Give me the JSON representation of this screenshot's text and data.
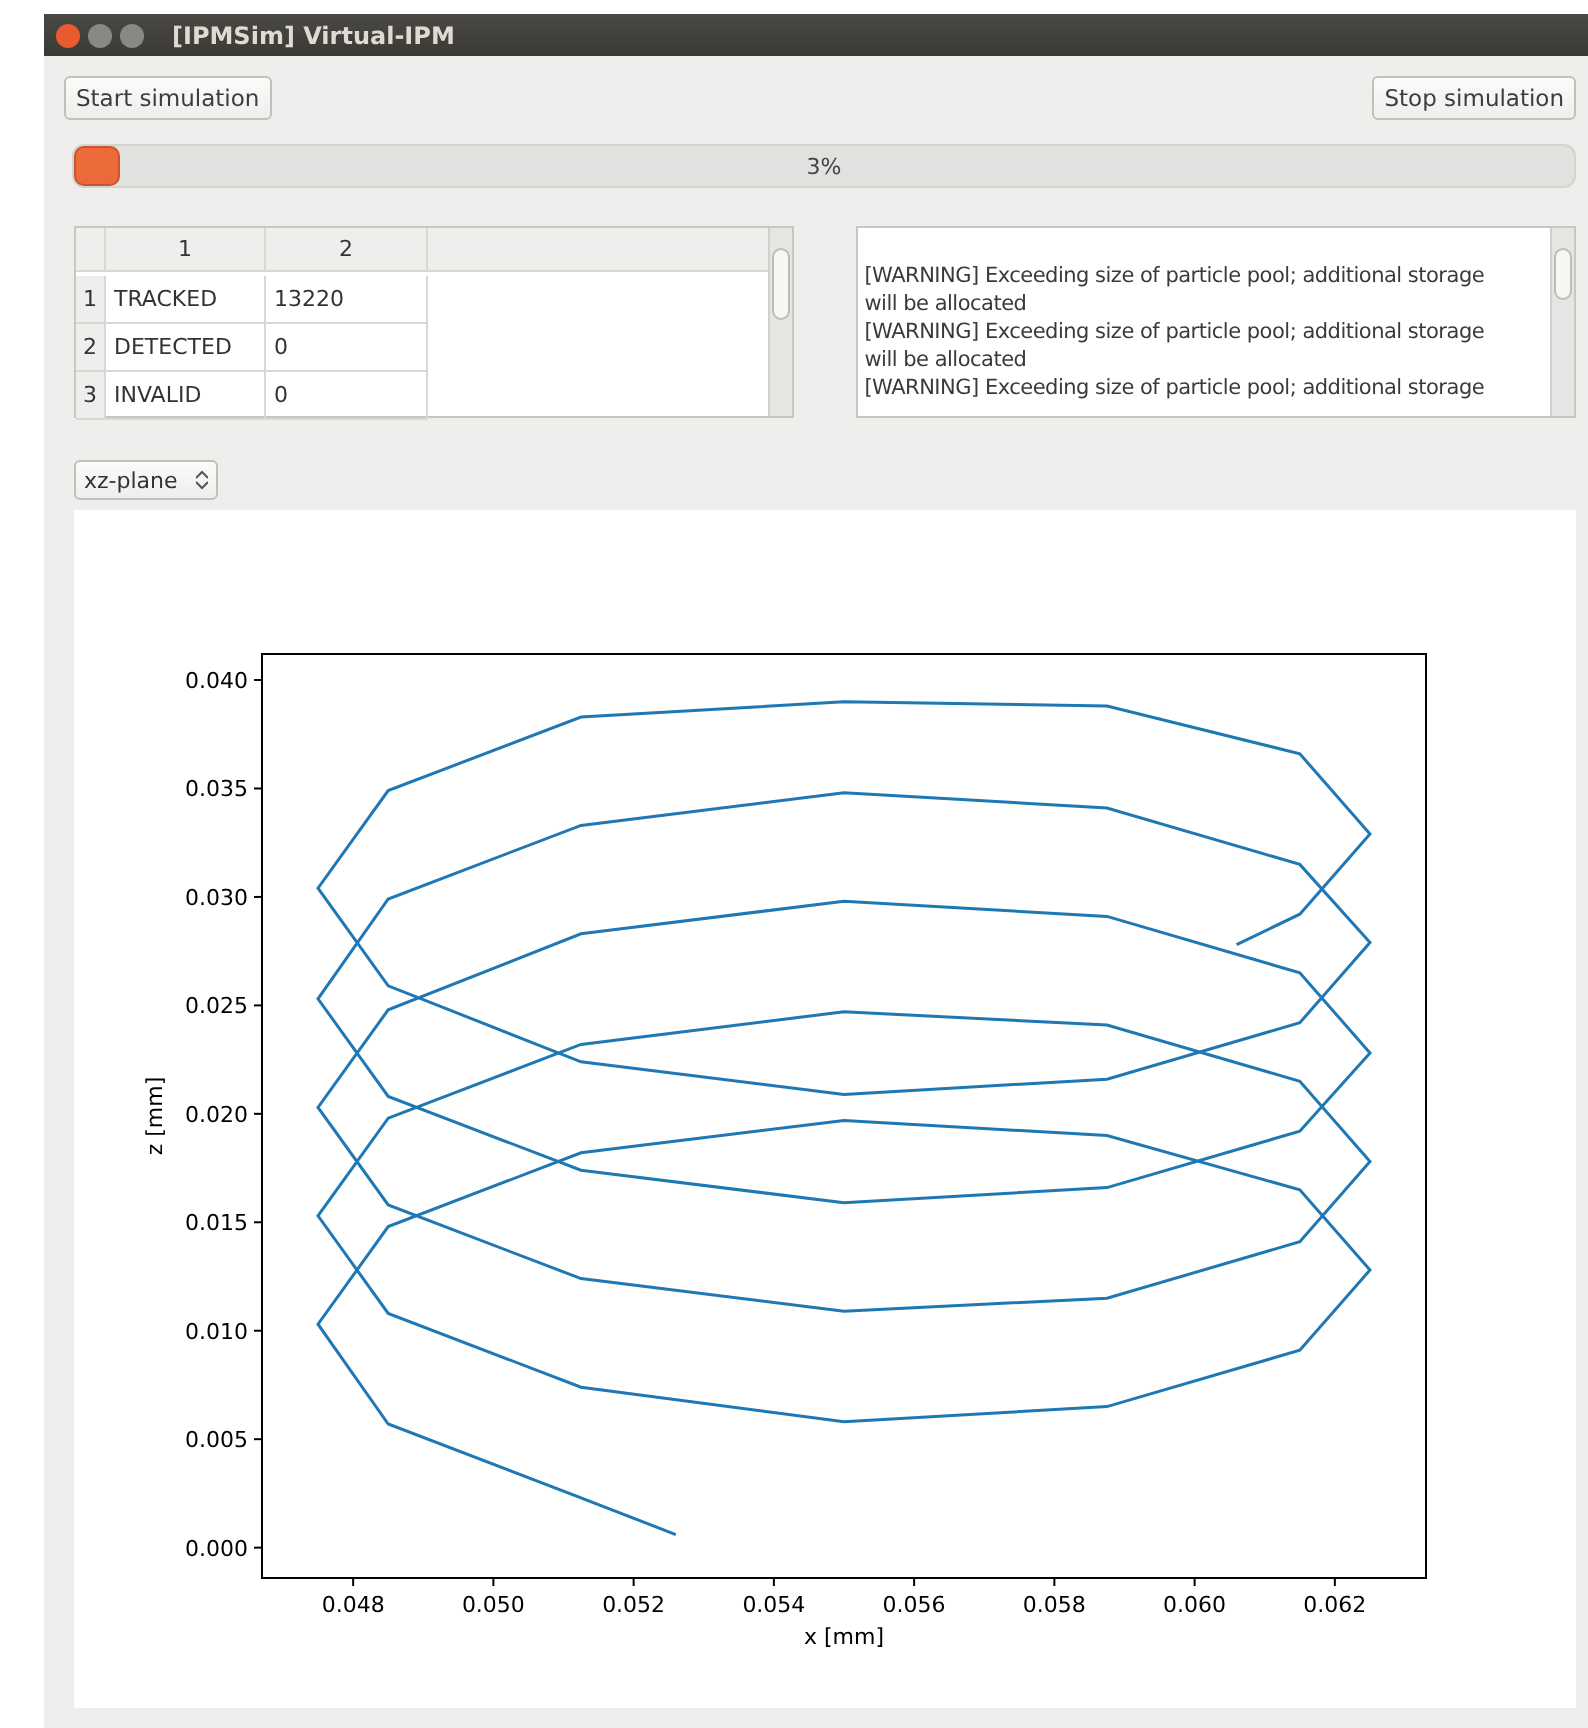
{
  "window": {
    "title": "[IPMSim] Virtual-IPM"
  },
  "buttons": [
    {
      "label": "Start simulation"
    },
    {
      "label": "Stop simulation"
    }
  ],
  "progress": {
    "level": 0.03,
    "label": "3%"
  },
  "table": {
    "columns": [
      "1",
      "2"
    ],
    "rows": [
      {
        "header": "1",
        "cells": [
          "TRACKED",
          "13220"
        ]
      },
      {
        "header": "2",
        "cells": [
          "DETECTED",
          "0"
        ]
      },
      {
        "header": "3",
        "cells": [
          "INVALID",
          "0"
        ]
      }
    ]
  },
  "log": {
    "lines": [
      "[WARNING] Exceeding size of particle pool; additional storage",
      "will be allocated",
      "[WARNING] Exceeding size of particle pool; additional storage",
      "will be allocated",
      "[WARNING] Exceeding size of particle pool; additional storage"
    ]
  },
  "plane_select": {
    "value": "xz-plane"
  },
  "plot": {
    "chart_data": {
      "type": "line",
      "xlabel": "x [mm]",
      "ylabel": "z [mm]",
      "xlim": [
        0.0467,
        0.0633
      ],
      "ylim": [
        -0.0014,
        0.0412
      ],
      "xticks": [
        {
          "value": 0.048,
          "label": "0.048"
        },
        {
          "value": 0.05,
          "label": "0.050"
        },
        {
          "value": 0.052,
          "label": "0.052"
        },
        {
          "value": 0.054,
          "label": "0.054"
        },
        {
          "value": 0.056,
          "label": "0.056"
        },
        {
          "value": 0.058,
          "label": "0.058"
        },
        {
          "value": 0.06,
          "label": "0.060"
        },
        {
          "value": 0.062,
          "label": "0.062"
        }
      ],
      "yticks": [
        {
          "value": 0,
          "label": "0.000"
        },
        {
          "value": 0.005,
          "label": "0.005"
        },
        {
          "value": 0.01,
          "label": "0.010"
        },
        {
          "value": 0.015,
          "label": "0.015"
        },
        {
          "value": 0.02,
          "label": "0.020"
        },
        {
          "value": 0.025,
          "label": "0.025"
        },
        {
          "value": 0.03,
          "label": "0.030"
        },
        {
          "value": 0.035,
          "label": "0.035"
        },
        {
          "value": 0.04,
          "label": "0.040"
        }
      ],
      "x": [
        0.0526,
        0.05125,
        0.0485,
        0.0475,
        0.0485,
        0.05125,
        0.055,
        0.05875,
        0.0615,
        0.0625,
        0.0615,
        0.05875,
        0.055,
        0.05125,
        0.0485,
        0.0475,
        0.0485,
        0.05125,
        0.055,
        0.05875,
        0.0615,
        0.0625,
        0.0615,
        0.05875,
        0.055,
        0.05125,
        0.0485,
        0.0475,
        0.0485,
        0.05125,
        0.055,
        0.05875,
        0.0615,
        0.0625,
        0.0615,
        0.05875,
        0.055,
        0.05125,
        0.0485,
        0.0475,
        0.0485,
        0.05125,
        0.055,
        0.05875,
        0.0615,
        0.0625,
        0.0615,
        0.05875,
        0.055,
        0.05125,
        0.0485,
        0.0475,
        0.0485,
        0.05125,
        0.055,
        0.05875,
        0.0615,
        0.0625,
        0.0615,
        0.0606
      ],
      "series": [
        {
          "color": "#1f77b4",
          "values": [
            0.0006,
            0.0023,
            0.0057,
            0.0103,
            0.0148,
            0.0182,
            0.0197,
            0.019,
            0.0165,
            0.0128,
            0.0091,
            0.0065,
            0.0058,
            0.0074,
            0.0108,
            0.0153,
            0.0198,
            0.0232,
            0.0247,
            0.0241,
            0.0215,
            0.0178,
            0.0141,
            0.0115,
            0.0109,
            0.0124,
            0.0158,
            0.0203,
            0.0248,
            0.0283,
            0.0298,
            0.0291,
            0.0265,
            0.0228,
            0.0192,
            0.0166,
            0.0159,
            0.0174,
            0.0208,
            0.0253,
            0.0299,
            0.0333,
            0.0348,
            0.0341,
            0.0315,
            0.0279,
            0.0242,
            0.0216,
            0.0209,
            0.0224,
            0.0259,
            0.0304,
            0.0349,
            0.0383,
            0.039,
            0.0388,
            0.0366,
            0.0329,
            0.0292,
            0.0278
          ]
        }
      ]
    }
  }
}
